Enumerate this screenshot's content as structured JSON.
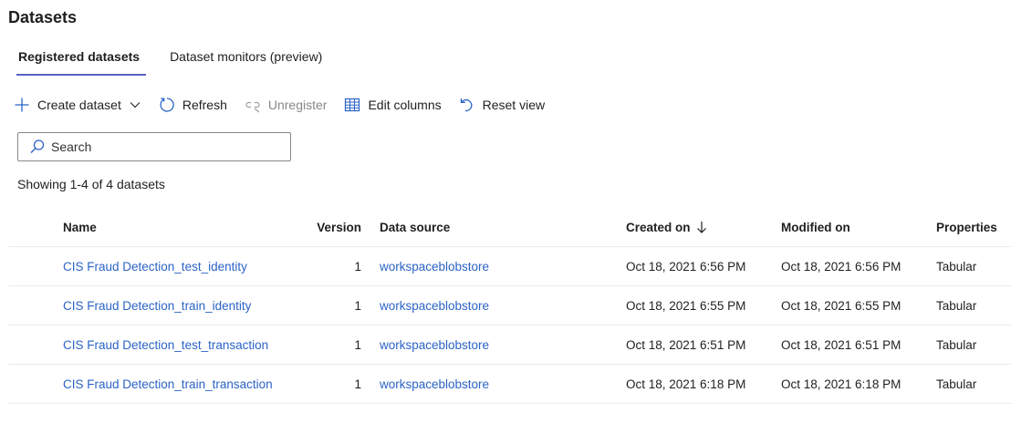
{
  "page": {
    "title": "Datasets"
  },
  "tabs": [
    {
      "label": "Registered datasets",
      "active": true
    },
    {
      "label": "Dataset monitors (preview)",
      "active": false
    }
  ],
  "toolbar": {
    "create_label": "Create dataset",
    "refresh_label": "Refresh",
    "unregister_label": "Unregister",
    "edit_columns_label": "Edit columns",
    "reset_view_label": "Reset view"
  },
  "search": {
    "placeholder": "Search",
    "value": ""
  },
  "summary": {
    "count_text": "Showing 1-4 of 4 datasets"
  },
  "table": {
    "headers": {
      "name": "Name",
      "version": "Version",
      "source": "Data source",
      "created": "Created on",
      "modified": "Modified on",
      "properties": "Properties"
    },
    "rows": [
      {
        "name": "CIS Fraud Detection_test_identity",
        "version": "1",
        "source": "workspaceblobstore",
        "created": "Oct 18, 2021 6:56 PM",
        "modified": "Oct 18, 2021 6:56 PM",
        "properties": "Tabular"
      },
      {
        "name": "CIS Fraud Detection_train_identity",
        "version": "1",
        "source": "workspaceblobstore",
        "created": "Oct 18, 2021 6:55 PM",
        "modified": "Oct 18, 2021 6:55 PM",
        "properties": "Tabular"
      },
      {
        "name": "CIS Fraud Detection_test_transaction",
        "version": "1",
        "source": "workspaceblobstore",
        "created": "Oct 18, 2021 6:51 PM",
        "modified": "Oct 18, 2021 6:51 PM",
        "properties": "Tabular"
      },
      {
        "name": "CIS Fraud Detection_train_transaction",
        "version": "1",
        "source": "workspaceblobstore",
        "created": "Oct 18, 2021 6:18 PM",
        "modified": "Oct 18, 2021 6:18 PM",
        "properties": "Tabular"
      }
    ]
  },
  "colors": {
    "accent": "#5b5fc7",
    "link": "#2b63c6",
    "icon": "#2b63c6",
    "disabled": "#8a8886"
  },
  "icons": [
    "add-icon",
    "chevron-down-icon",
    "refresh-icon",
    "unregister-icon",
    "edit-columns-icon",
    "reset-view-icon",
    "search-icon",
    "sort-descending-icon"
  ]
}
